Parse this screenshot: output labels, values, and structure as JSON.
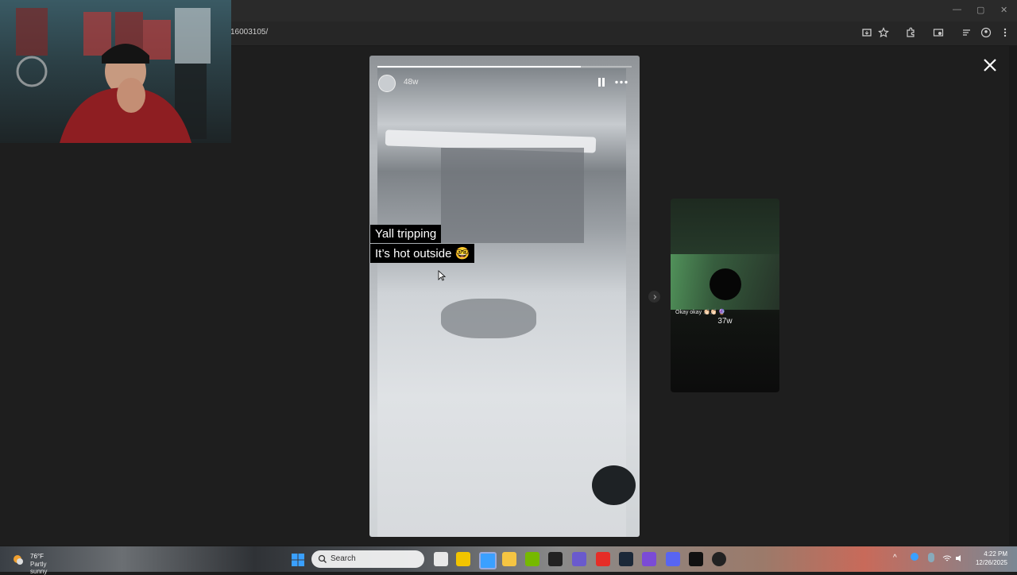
{
  "browser": {
    "url": "16003105/",
    "window_controls": {
      "minimize": "—",
      "restore": "▢",
      "close": "✕"
    },
    "toolbar_icons": [
      "install-icon",
      "star-icon",
      "extensions-icon",
      "media-icon",
      "reading-list-icon",
      "profile-icon",
      "menu-icon"
    ]
  },
  "story": {
    "time_ago": "48w",
    "progress": 0.8,
    "caption_line1": "Yall tripping",
    "caption_line2": "It’s hot outside 🤓"
  },
  "next_story": {
    "text": "Okay okay 👏🏻👏🏻",
    "emoji": "🔮",
    "time_ago": "37w"
  },
  "taskbar": {
    "weather_temp": "76°F",
    "weather_condition": "Partly sunny",
    "search_label": "Search",
    "clock_time": "4:22 PM",
    "clock_date": "12/26/2025",
    "accent": "#0078d4"
  }
}
